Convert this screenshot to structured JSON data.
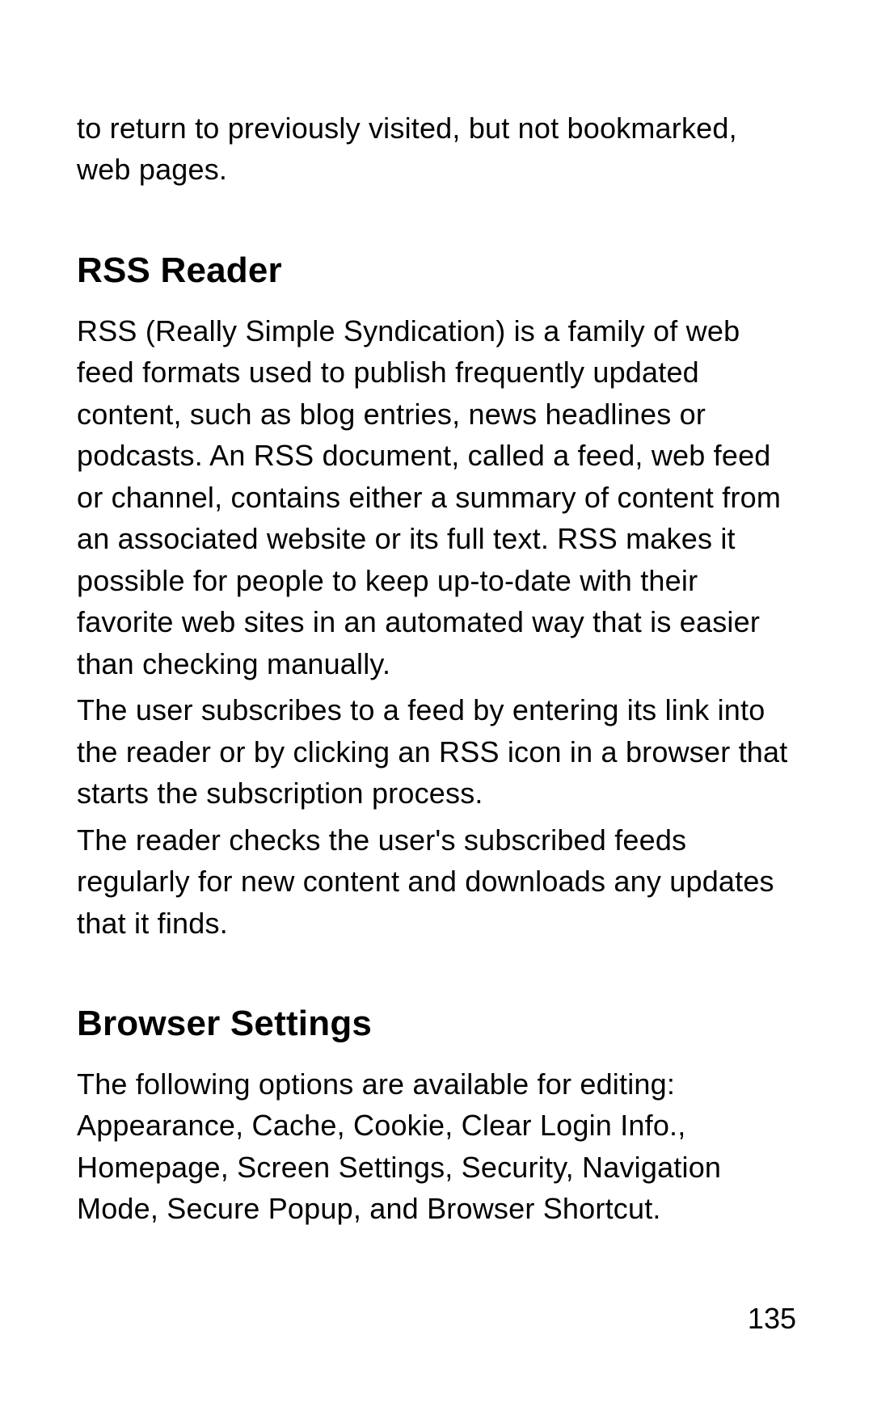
{
  "intro_fragment": "to return to previously visited, but not bookmarked, web pages.",
  "sections": [
    {
      "heading": "RSS Reader",
      "paragraphs": [
        "RSS (Really Simple Syndication) is a family of web feed formats used to publish frequently updated content, such as blog entries, news headlines or podcasts. An RSS document, called a feed, web feed or channel, contains either a summary of content from an associated website or its full text. RSS makes it possible for people to keep up-to-date with their favorite web sites in an automated way that is easier than checking manually.",
        "The user subscribes to a feed by entering its link into the reader or by clicking an RSS icon in a browser that starts the subscription process.",
        "The reader checks the user's subscribed feeds regularly for new content and downloads any updates that it finds."
      ]
    },
    {
      "heading": "Browser Settings",
      "paragraphs": [
        "The following options are available for editing: Appearance, Cache, Cookie, Clear Login Info., Homepage, Screen Settings, Security, Navigation Mode, Secure Popup, and Browser Shortcut."
      ]
    }
  ],
  "page_number": "135"
}
